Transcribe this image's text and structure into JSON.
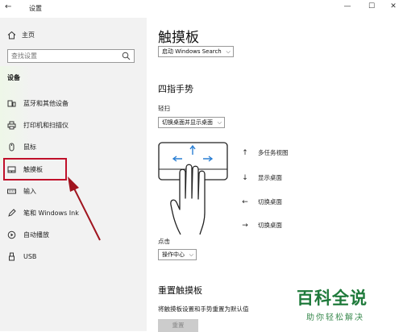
{
  "window": {
    "title": "设置",
    "back_glyph": "←",
    "minimize": "—",
    "maximize": "☐",
    "close": "✕"
  },
  "sidebar": {
    "home_label": "主页",
    "search_placeholder": "查找设置",
    "section": "设备",
    "items": [
      {
        "label": "蓝牙和其他设备",
        "icon": "bluetooth-devices-icon"
      },
      {
        "label": "打印机和扫描仪",
        "icon": "printer-icon"
      },
      {
        "label": "鼠标",
        "icon": "mouse-icon"
      },
      {
        "label": "触摸板",
        "icon": "touchpad-icon"
      },
      {
        "label": "输入",
        "icon": "keyboard-icon"
      },
      {
        "label": "笔和 Windows Ink",
        "icon": "pen-icon"
      },
      {
        "label": "自动播放",
        "icon": "autoplay-icon"
      },
      {
        "label": "USB",
        "icon": "usb-icon"
      }
    ]
  },
  "main": {
    "title": "触摸板",
    "windows_search_select": "启动 Windows Search",
    "four_finger_heading": "四指手势",
    "swipe_label": "轻扫",
    "swipe_select": "切换桌面并显示桌面",
    "gestures": [
      {
        "arrow": "↑",
        "label": "多任务视图"
      },
      {
        "arrow": "↓",
        "label": "显示桌面"
      },
      {
        "arrow": "←",
        "label": "切换桌面"
      },
      {
        "arrow": "→",
        "label": "切换桌面"
      }
    ],
    "tap_label": "点击",
    "tap_select": "操作中心",
    "reset_heading": "重置触摸板",
    "reset_desc": "将触摸板设置和手势重置为默认值",
    "reset_button": "重置"
  },
  "watermark": {
    "big": "百科全说",
    "small": "助你轻松解决"
  },
  "colors": {
    "sidebar_bg": "#f2f2f2",
    "highlight": "#c0102a",
    "gesture_blue": "#2a7fd4",
    "watermark": "#1f7a3b"
  }
}
